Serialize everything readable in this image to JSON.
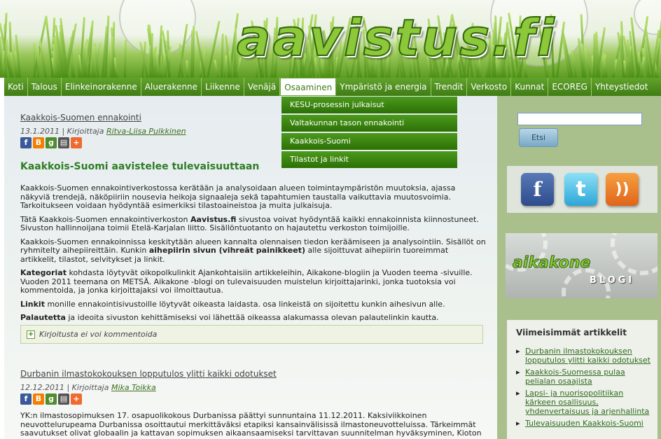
{
  "logo": {
    "text": "aavistus.fi"
  },
  "nav": {
    "items": [
      "Koti",
      "Talous",
      "Elinkeinorakenne",
      "Aluerakenne",
      "Liikenne",
      "Venäjä",
      "Osaaminen",
      "Ympäristö ja energia",
      "Trendit",
      "Verkosto",
      "Kunnat",
      "ECOREG",
      "Yhteystiedot"
    ],
    "active": "Osaaminen"
  },
  "dropdown": {
    "items": [
      "KESU-prosessin julkaisut",
      "Valtakunnan tason ennakointi",
      "Kaakkois-Suomi",
      "Tilastot ja linkit"
    ]
  },
  "articles": [
    {
      "title": "Kaakkois-Suomen ennakointi",
      "date": "13.1.2011",
      "sep": " | Kirjoittaja ",
      "author": "Ritva-Liisa Pulkkinen",
      "headline": "Kaakkois-Suomi aavistelee tulevaisuuttaan",
      "p1": "Kaakkois-Suomen ennakointiverkostossa kerätään ja analysoidaan alueen toimintaympäristön muutoksia, ajassa näkyviä trendejä, näköpiiriin nousevia heikoja signaaleja sekä tapahtumien taustalla vaikuttavia muutosvoimia. Tarkoitukseen voidaan hyödyntää esimerkiksi tilastoaineistoa ja muita julkaisuja.",
      "p2a": "Tätä Kaakkois-Suomen ennakointiverkoston ",
      "p2b": "Aavistus.fi",
      "p2c": " sivustoa voivat hyödyntää kaikki  ennakoinnista kiinnostuneet. Sivuston hallinnoijana toimii Etelä-Karjalan liitto. Sisällöntuotanto on hajautettu verkoston toimijoille.",
      "p3a": "Kaakkois-Suomen ennakoinnissa keskitytään alueen kannalta olennaisen tiedon keräämiseen ja analysointiin. Sisällöt on ryhmitelty aihepiireittäin. Kunkin ",
      "p3b": "aihepiirin sivun (vihreät painikkeet)",
      "p3c": " alle sijoittuvat aihepiirin tuoreimmat artikkelit, tilastot, selvitykset ja linkit.",
      "p4a": "Kategoriat",
      "p4b": " kohdasta löytyvät oikopolkulinkit Ajankohtaisiin artikkeleihin, Aikakone-blogiin ja Vuoden teema -sivuille. Vuoden 2011 teemana on METSÄ. Aikakone -blogi on tulevaisuuden muistelun kirjoittajarinki, jonka tuotoksia voi kommentoida, ja jonka kirjoittajaksi voi ilmoittautua.",
      "p5a": "Linkit",
      "p5b": " monille ennakointisivustoille löytyvät oikeasta laidasta. osa linkeistä on sijoitettu kunkin aihesivun alle.",
      "p6a": "Palautetta",
      "p6b": " ja ideoita sivuston kehittämiseksi voi lähettää oikeassa alakumassa olevan palautelinkin kautta.",
      "comments": "Kirjoitusta ei voi kommentoida"
    },
    {
      "title": "Durbanin ilmastokokouksen lopputulos ylitti kaikki odotukset",
      "date": "12.12.2011",
      "sep": " | Kirjoittaja ",
      "author": "Mika Toikka",
      "p1": "YK:n ilmastosopimuksen 17. osapuolikokous Durbanissa päättyi sunnuntaina 11.12.2011. Kaksiviikkoinen neuvottelurupeama Durbanissa osoittautui merkittäväksi etapiksi kansainvälisissä ilmastoneuvotteluissa. Tärkeimmät saavutukset olivat globaalin ja kattavan sopimuksen aikaansaamiseksi tarvittavan suunnitelman hyväksyminen, Kioton pöytäkirjan jatkaminen toisella velvoitekaudella sekä uuden pöytäkirjan valmistelun käynnistäminen."
    }
  ],
  "sidebar": {
    "search_button": "Etsi",
    "social": {
      "facebook": "f",
      "twitter": "t",
      "rss": "))"
    },
    "aikakone": {
      "word": "aikakone",
      "sub": "BLOGI"
    },
    "latest_title": "Viimeisimmät artikkelit",
    "latest": [
      "Durbanin ilmastokokouksen lopputulos ylitti kaikki odotukset",
      "Kaakkois-Suomessa pulaa pelialan osaajista",
      "Lapsi- ja nuorisopolitiikan kärkeen osallisuus, yhdenvertaisuus ja arjenhallinta",
      "Tulevaisuuden Kaakkois-Suomi"
    ]
  }
}
